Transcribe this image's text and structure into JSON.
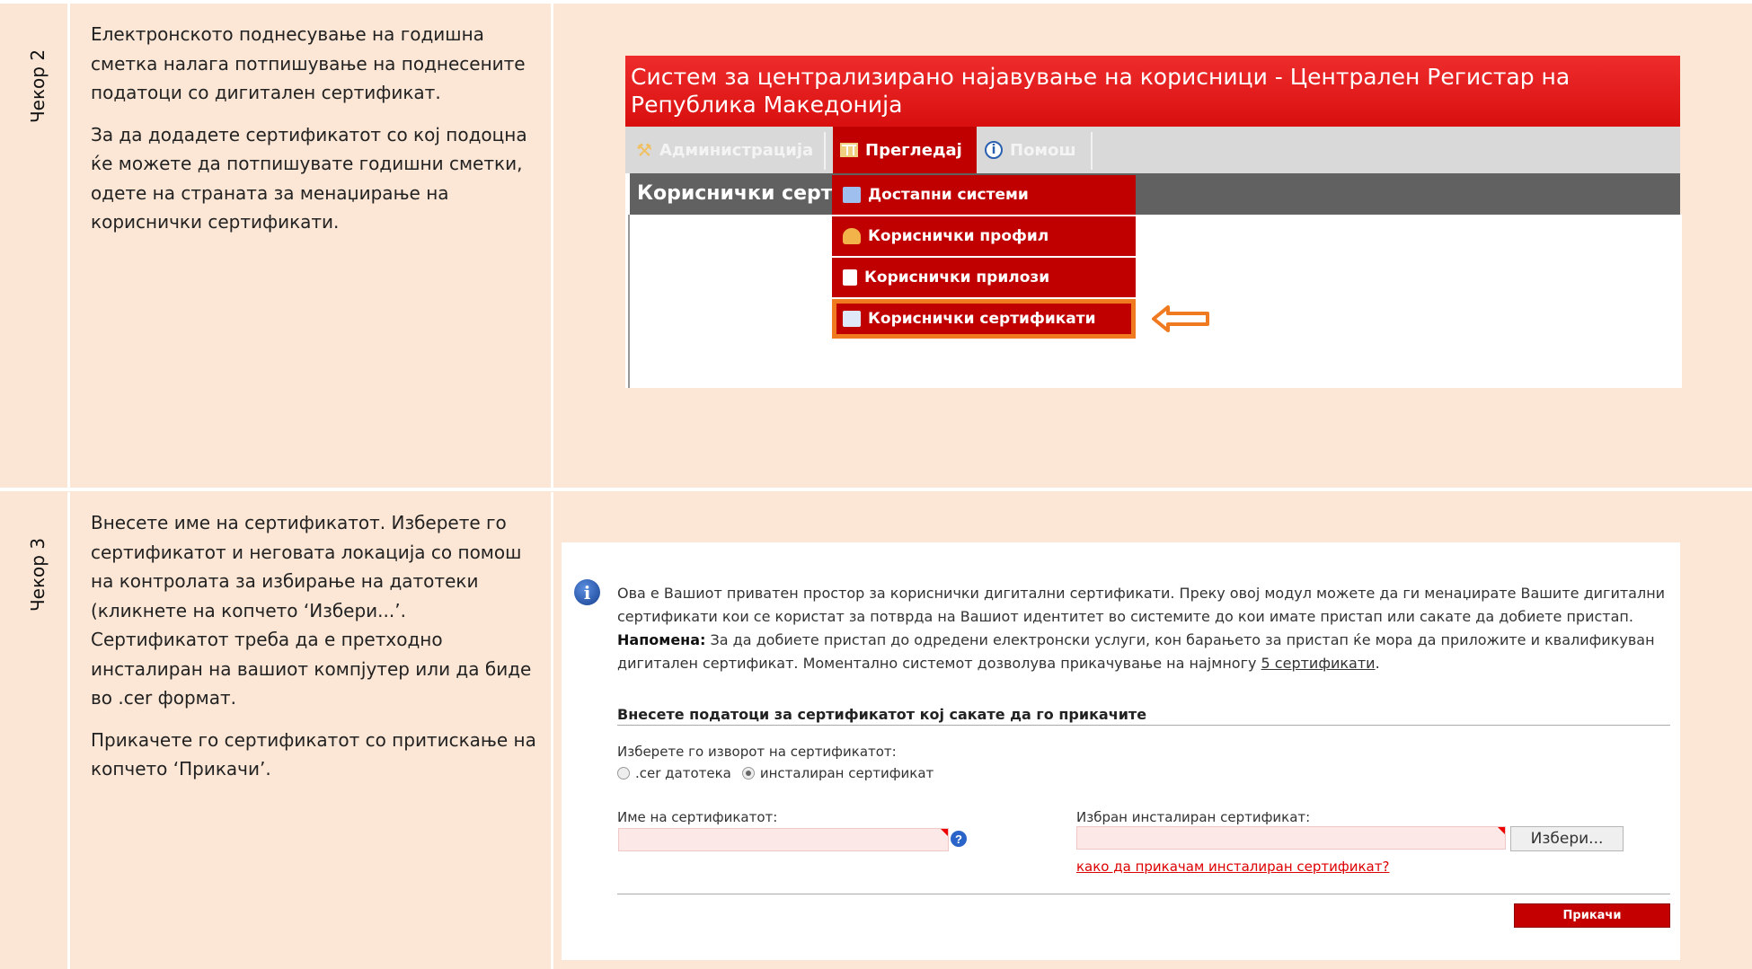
{
  "steps": [
    {
      "label": "Чекор 2",
      "paragraphs": [
        "Електронското поднесување на годишна сметка налага потпишување на поднесените податоци со дигитален сертификат.",
        "За да додадете сертификатот со кој подоцна ќе можете да потпишувате годишни сметки, одете на страната за менаџирање на кориснички сертификати."
      ]
    },
    {
      "label": "Чекор 3",
      "paragraphs": [
        "Внесете име на сертификатот. Изберете го сертификатот и неговата локација со помош на контролата за избирање на датотеки (кликнете на копчето ‘Избери...’. Сертификатот треба да е претходно инсталиран на вашиот компјутер или да биде во .cer формат.",
        "Прикачете го сертификатот со притискање на копчето ‘Прикачи’."
      ]
    }
  ],
  "app2": {
    "header": "Систем за централизирано најавување на корисници - Централен Регистар на Република Македонија",
    "nav": {
      "admin": "Администрација",
      "view": "Прегледај",
      "help": "Помош"
    },
    "page_title": "Кориснички серти",
    "menu": [
      "Достапни системи",
      "Кориснички профил",
      "Кориснички прилози",
      "Кориснички сертификати"
    ],
    "selected_index": 3,
    "accent": "#c00000",
    "highlight_color": "#f07a1f"
  },
  "app3": {
    "info_line1": "Ова е Вашиот приватен простор за кориснички дигитални сертификати. Преку овој модул можете да ги менаџирате Вашите дигитални сертификати кои се користат за потврда на Вашиот идентитет во системите до кои имате пристап или сакате да добиете пристап.",
    "note_label": "Напомена:",
    "note_text": " За да добиете пристап до одредени електронски услуги, кон барањето за пристап ќе мора да приложите и квалификуван дигитален сертификат. Моментално системот дозволува прикачување на најмногу ",
    "note_limit": "5 сертификати",
    "note_end": ".",
    "section_title": "Внесете податоци за сертификатот кој сакате да го прикачите",
    "source_label": "Изберете го изворот на сертификатот:",
    "source_options": [
      ".cer датотека",
      "инсталиран сертификат"
    ],
    "source_selected": "инсталиран сертификат",
    "name_label": "Име на сертификатот:",
    "name_value": "",
    "installed_label": "Избран инсталиран сертификат:",
    "installed_value": "",
    "choose_button": "Избери...",
    "howto_link": "како да прикачам инсталиран сертификат?",
    "attach_button": "Прикачи"
  }
}
